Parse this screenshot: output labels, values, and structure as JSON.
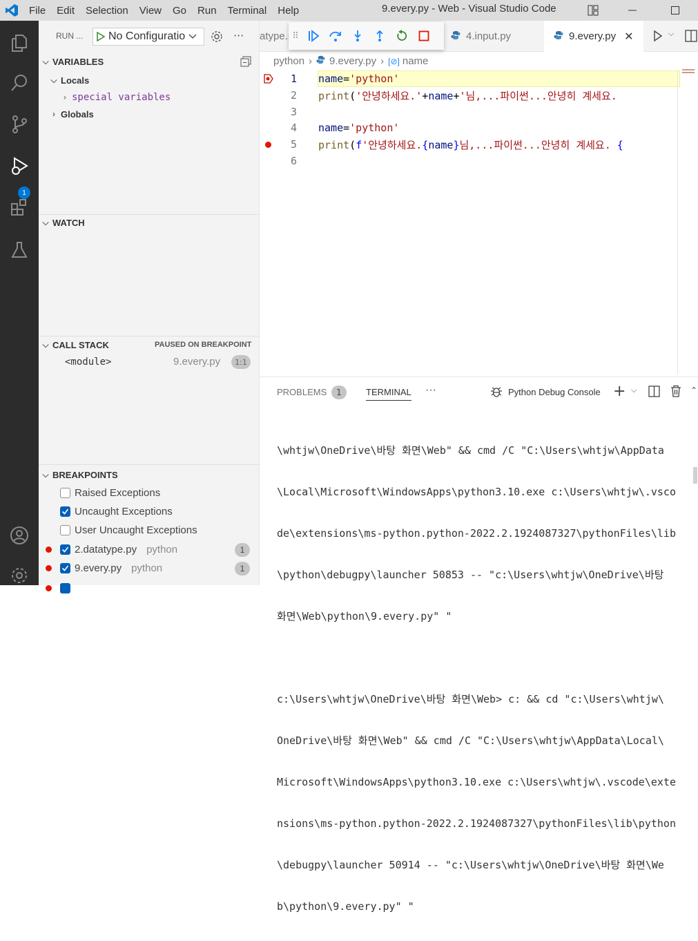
{
  "titlebar": {
    "menu": [
      "File",
      "Edit",
      "Selection",
      "View",
      "Go",
      "Run",
      "Terminal",
      "Help"
    ],
    "title": "9.every.py - Web - Visual Studio Code"
  },
  "activity": {
    "debug_badge": "1"
  },
  "sidebar": {
    "run_label": "RUN ...",
    "configuration": "No Configurations",
    "variables": {
      "title": "VARIABLES",
      "locals": "Locals",
      "special": "special variables",
      "globals": "Globals"
    },
    "watch": {
      "title": "WATCH"
    },
    "callstack": {
      "title": "CALL STACK",
      "status": "PAUSED ON BREAKPOINT",
      "frame": "<module>",
      "file": "9.every.py",
      "pos": "1:1"
    },
    "breakpoints": {
      "title": "BREAKPOINTS",
      "items": [
        {
          "label": "Raised Exceptions",
          "checked": false
        },
        {
          "label": "Uncaught Exceptions",
          "checked": true
        },
        {
          "label": "User Uncaught Exceptions",
          "checked": false
        }
      ],
      "files": [
        {
          "name": "2.datatype.py",
          "folder": "python",
          "count": "1"
        },
        {
          "name": "9.every.py",
          "folder": "python",
          "count": "1"
        }
      ]
    }
  },
  "editor": {
    "tabs": [
      {
        "label": "atype.py"
      },
      {
        "label": "4.input.py"
      },
      {
        "label": "9.every.py"
      }
    ],
    "breadcrumb": {
      "folder": "python",
      "file": "9.every.py",
      "symbol": "name"
    },
    "lines": [
      "1",
      "2",
      "3",
      "4",
      "5",
      "6"
    ]
  },
  "panel": {
    "tabs": {
      "problems": "PROBLEMS",
      "problems_count": "1",
      "terminal": "TERMINAL",
      "more": "···"
    },
    "console": "Python Debug Console",
    "terminal_lines": [
      "\\whtjw\\OneDrive\\바탕 화면\\Web\" && cmd /C \"C:\\Users\\whtjw\\AppData",
      "\\Local\\Microsoft\\WindowsApps\\python3.10.exe c:\\Users\\whtjw\\.vsco",
      "de\\extensions\\ms-python.python-2022.2.1924087327\\pythonFiles\\lib",
      "\\python\\debugpy\\launcher 50853 -- \"c:\\Users\\whtjw\\OneDrive\\바탕",
      "화면\\Web\\python\\9.every.py\" \"",
      "",
      "c:\\Users\\whtjw\\OneDrive\\바탕 화면\\Web> c: && cd \"c:\\Users\\whtjw\\",
      "OneDrive\\바탕 화면\\Web\" && cmd /C \"C:\\Users\\whtjw\\AppData\\Local\\",
      "Microsoft\\WindowsApps\\python3.10.exe c:\\Users\\whtjw\\.vscode\\exte",
      "nsions\\ms-python.python-2022.2.1924087327\\pythonFiles\\lib\\python",
      "\\debugpy\\launcher 50914 -- \"c:\\Users\\whtjw\\OneDrive\\바탕 화면\\We",
      "b\\python\\9.every.py\" \""
    ]
  }
}
